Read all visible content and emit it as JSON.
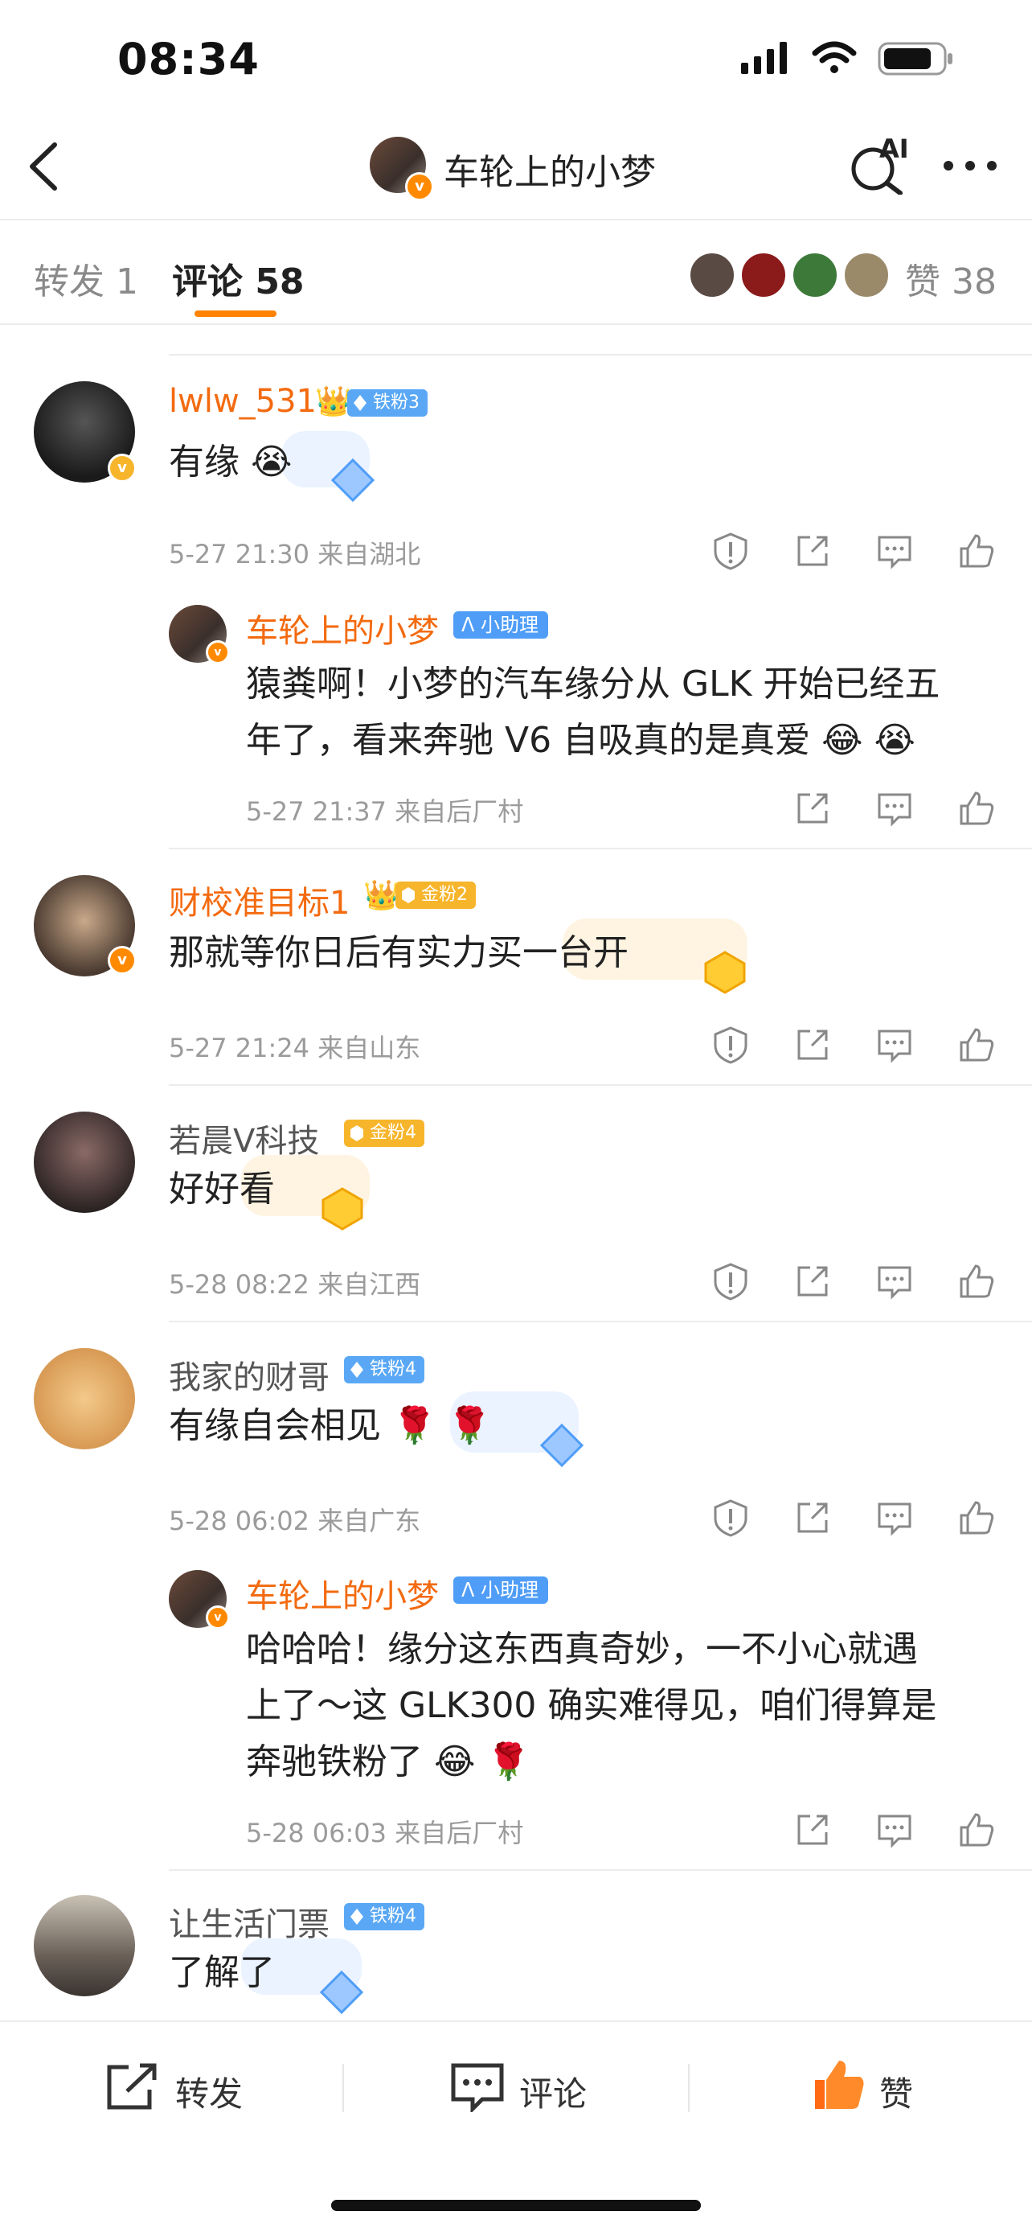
{
  "status_bar": {
    "time": "08:34"
  },
  "nav": {
    "title": "车轮上的小梦",
    "ai_label": "AI"
  },
  "tabs": {
    "repost": "转发 1",
    "comments": "评论 58",
    "likes": "赞 38"
  },
  "colors": {
    "accent": "#ff8200",
    "username_orange": "#f36a0f",
    "iron_fan": "#5aa8f5",
    "gold_fan": "#f7b52c",
    "like_active": "#ff6a13"
  },
  "comments": [
    {
      "username": "lwlw_531",
      "badge": "铁粉3",
      "text": "有缘",
      "time": "5-27 21:30",
      "location": "来自湖北",
      "reply": {
        "username": "车轮上的小梦",
        "badge": "小助理",
        "text_line1": "猿粪啊！小梦的汽车缘分从 GLK 开始已经五",
        "text_line2": "年了，看来奔驰 V6 自吸真的是真爱",
        "time": "5-27 21:37",
        "location": "来自后厂村"
      }
    },
    {
      "username": "财校准目标1",
      "badge": "金粉2",
      "text": "那就等你日后有实力买一台开",
      "time": "5-27 21:24",
      "location": "来自山东"
    },
    {
      "username": "若晨Ⅴ科技",
      "badge": "金粉4",
      "text": "好好看",
      "time": "5-28 08:22",
      "location": "来自江西"
    },
    {
      "username": "我家的财哥",
      "badge": "铁粉4",
      "text": "有缘自会相见",
      "time": "5-28 06:02",
      "location": "来自广东",
      "reply": {
        "username": "车轮上的小梦",
        "badge": "小助理",
        "text_line1": "哈哈哈！缘分这东西真奇妙，一不小心就遇",
        "text_line2": "上了～这 GLK300 确实难得见，咱们得算是",
        "text_line3": "奔驰铁粉了",
        "time": "5-28 06:03",
        "location": "来自后厂村"
      }
    },
    {
      "username": "让生活门票",
      "badge": "铁粉4",
      "text": "了解了"
    }
  ],
  "bottom_bar": {
    "repost": "转发",
    "comment": "评论",
    "like": "赞"
  }
}
